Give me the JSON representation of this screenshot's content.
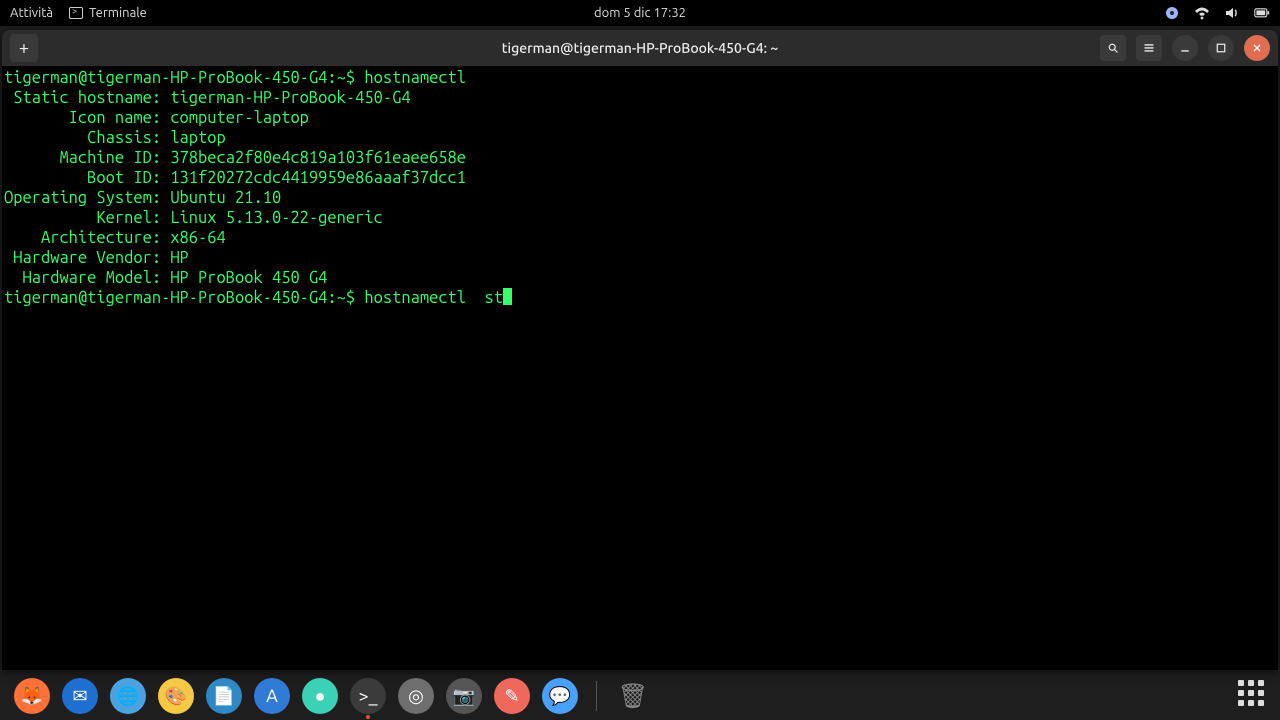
{
  "topbar": {
    "activities": "Attività",
    "app_name": "Terminale",
    "clock": "dom 5 dic  17:32"
  },
  "titlebar": {
    "title": "tigerman@tigerman-HP-ProBook-450-G4: ~",
    "newtab_label": "+"
  },
  "terminal": {
    "prompt1_user": "tigerman@tigerman-HP-ProBook-450-G4",
    "prompt1_cwd": "~",
    "prompt1_cmd": "hostnamectl",
    "output": [
      {
        "label": " Static hostname:",
        "value": "tigerman-HP-ProBook-450-G4"
      },
      {
        "label": "       Icon name:",
        "value": "computer-laptop"
      },
      {
        "label": "         Chassis:",
        "value": "laptop"
      },
      {
        "label": "      Machine ID:",
        "value": "378beca2f80e4c819a103f61eaee658e"
      },
      {
        "label": "         Boot ID:",
        "value": "131f20272cdc4419959e86aaaf37dcc1"
      },
      {
        "label": "Operating System:",
        "value": "Ubuntu 21.10"
      },
      {
        "label": "          Kernel:",
        "value": "Linux 5.13.0-22-generic"
      },
      {
        "label": "    Architecture:",
        "value": "x86-64"
      },
      {
        "label": " Hardware Vendor:",
        "value": "HP"
      },
      {
        "label": "  Hardware Model:",
        "value": "HP ProBook 450 G4"
      }
    ],
    "prompt2_user": "tigerman@tigerman-HP-ProBook-450-G4",
    "prompt2_cwd": "~",
    "prompt2_cmd": "hostnamectl  st"
  },
  "dock": {
    "items": [
      {
        "name": "firefox",
        "color": "#ff7139",
        "glyph": "🦊"
      },
      {
        "name": "thunderbird",
        "color": "#1f6fd0",
        "glyph": "✉"
      },
      {
        "name": "web-browser",
        "color": "#4aa3df",
        "glyph": "🌐"
      },
      {
        "name": "color-picker",
        "color": "#f6c945",
        "glyph": "🎨"
      },
      {
        "name": "libreoffice",
        "color": "#2e89c5",
        "glyph": "📄"
      },
      {
        "name": "software-store",
        "color": "#2f7bd6",
        "glyph": "A"
      },
      {
        "name": "signal",
        "color": "#3bd1b5",
        "glyph": "●"
      },
      {
        "name": "terminal",
        "color": "#3b3b3b",
        "glyph": ">_"
      },
      {
        "name": "disks",
        "color": "#6e6e6e",
        "glyph": "◎"
      },
      {
        "name": "camera",
        "color": "#555555",
        "glyph": "📷"
      },
      {
        "name": "notes",
        "color": "#f0675c",
        "glyph": "✎"
      },
      {
        "name": "chat",
        "color": "#4aa0ff",
        "glyph": "💬"
      }
    ],
    "trash": {
      "name": "trash",
      "glyph": "🗑",
      "color": "#888"
    },
    "active_index": 7
  }
}
